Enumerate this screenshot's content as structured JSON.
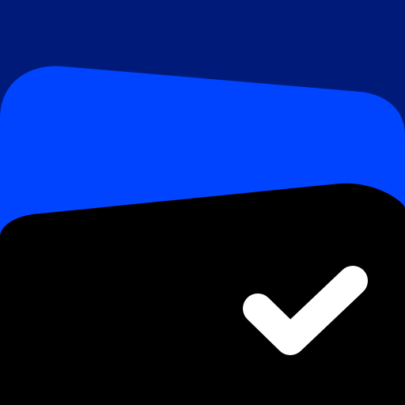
{
  "icon": {
    "name": "wallet-check-app-icon",
    "colors": {
      "background": "#001a7a",
      "back_card": "#0044ff",
      "front_card": "#000000",
      "checkmark": "#ffffff"
    }
  }
}
